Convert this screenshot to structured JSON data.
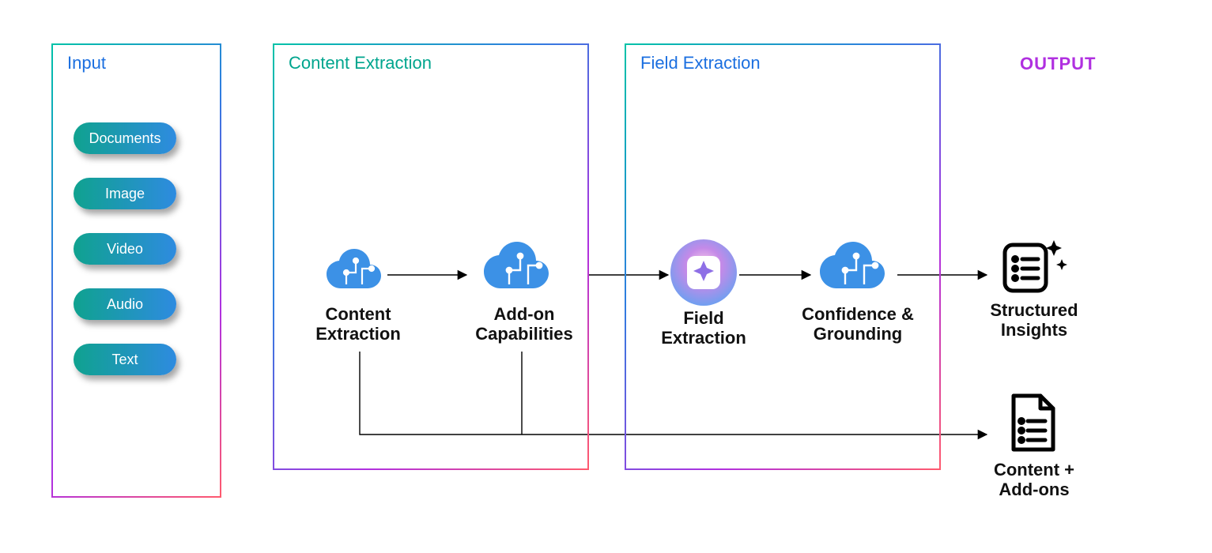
{
  "input_panel": {
    "title": "Input",
    "title_color": "#1b6fe0"
  },
  "content_panel": {
    "title": "Content Extraction",
    "title_color": "#00a58e"
  },
  "field_panel": {
    "title": "Field Extraction",
    "title_color": "#1b6fe0"
  },
  "output_label": {
    "text": "OUTPUT",
    "color": "#b030e0"
  },
  "inputs": [
    "Documents",
    "Image",
    "Video",
    "Audio",
    "Text"
  ],
  "nodes": {
    "content_extraction": "Content\nExtraction",
    "addon_caps": "Add-on\nCapabilities",
    "field_extraction": "Field\nExtraction",
    "conf_ground": "Confidence &\nGrounding",
    "structured_insights": "Structured\nInsights",
    "content_addons": "Content +\nAdd-ons"
  }
}
